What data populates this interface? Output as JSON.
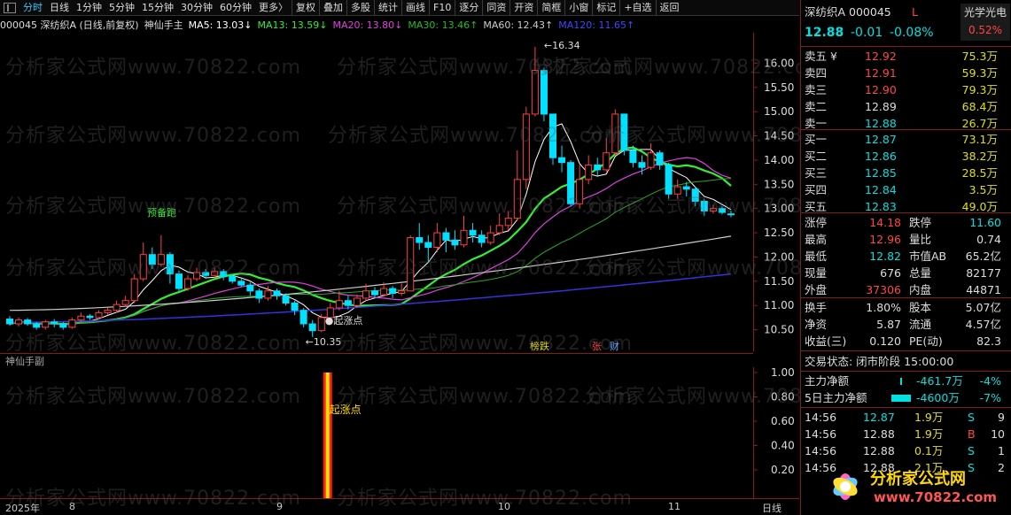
{
  "toolbar": {
    "items": [
      "分时",
      "日线",
      "1分钟",
      "5分钟",
      "15分钟",
      "30分钟",
      "60分钟",
      "更多〉",
      "复权",
      "叠加",
      "多股",
      "统计",
      "画线",
      "F10",
      "逐分",
      "同资",
      "开资",
      "简框",
      "小窗",
      "标记",
      "+自选",
      "返回"
    ]
  },
  "info": {
    "code_title": "000045 深纺织A (日线,前复权)",
    "indicator": "神仙手主",
    "ma5": "MA5: 13.03↓",
    "ma13": "MA13: 13.59↓",
    "ma20": "MA20: 13.80↓",
    "ma30": "MA30: 13.46↑",
    "ma60": "MA60: 12.43↑",
    "ma120": "MA120: 11.65↑"
  },
  "colors": {
    "ma5": "#ffffff",
    "ma13": "#33ee33",
    "ma20": "#e040e0",
    "ma30": "#22aa22",
    "ma60": "#cccccc",
    "ma120": "#3333dd",
    "up": "#ff4040",
    "down": "#00e0ff"
  },
  "chart_data": {
    "type": "candlestick",
    "y_ticks": [
      "16.00",
      "15.50",
      "15.00",
      "14.50",
      "14.00",
      "13.50",
      "13.00",
      "12.50",
      "12.00",
      "11.50",
      "11.00",
      "10.50"
    ],
    "ylim": [
      10.2,
      16.3
    ],
    "x_labels": [
      "2025年",
      "8",
      "9",
      "10",
      "11",
      "日线"
    ],
    "annotations": {
      "high": "16.34",
      "low": "10.35",
      "start": "●起涨点",
      "ready": "预备跑",
      "bang": "榜跌",
      "zhang": "张",
      "cai": "财"
    },
    "candles": [
      [
        10.72,
        10.62,
        10.78,
        10.58
      ],
      [
        10.62,
        10.7,
        10.75,
        10.57
      ],
      [
        10.7,
        10.62,
        10.74,
        10.58
      ],
      [
        10.62,
        10.55,
        10.66,
        10.5
      ],
      [
        10.55,
        10.66,
        10.7,
        10.5
      ],
      [
        10.66,
        10.62,
        10.72,
        10.55
      ],
      [
        10.62,
        10.55,
        10.66,
        10.5
      ],
      [
        10.55,
        10.7,
        10.75,
        10.52
      ],
      [
        10.7,
        10.78,
        10.85,
        10.66
      ],
      [
        10.78,
        10.75,
        10.82,
        10.7
      ],
      [
        10.75,
        10.85,
        10.9,
        10.72
      ],
      [
        10.85,
        10.9,
        10.95,
        10.8
      ],
      [
        10.9,
        11.02,
        11.1,
        10.85
      ],
      [
        11.02,
        11.1,
        11.2,
        10.98
      ],
      [
        11.1,
        11.55,
        11.65,
        11.05
      ],
      [
        11.55,
        12.05,
        12.3,
        11.5
      ],
      [
        12.05,
        11.85,
        12.2,
        11.75
      ],
      [
        11.85,
        12.05,
        12.45,
        11.8
      ],
      [
        12.05,
        11.65,
        12.1,
        11.45
      ],
      [
        11.65,
        11.35,
        11.72,
        11.28
      ],
      [
        11.35,
        11.55,
        11.62,
        11.3
      ],
      [
        11.55,
        11.68,
        11.78,
        11.5
      ],
      [
        11.68,
        11.62,
        11.75,
        11.55
      ],
      [
        11.62,
        11.7,
        11.78,
        11.56
      ],
      [
        11.7,
        11.6,
        11.75,
        11.52
      ],
      [
        11.6,
        11.5,
        11.65,
        11.45
      ],
      [
        11.5,
        11.42,
        11.55,
        11.38
      ],
      [
        11.42,
        11.3,
        11.48,
        11.2
      ],
      [
        11.3,
        11.15,
        11.35,
        11.05
      ],
      [
        11.15,
        11.3,
        11.4,
        11.1
      ],
      [
        11.3,
        11.2,
        11.35,
        11.12
      ],
      [
        11.2,
        11.05,
        11.25,
        11.0
      ],
      [
        11.05,
        10.9,
        11.1,
        10.8
      ],
      [
        10.9,
        10.62,
        10.95,
        10.55
      ],
      [
        10.62,
        10.48,
        10.7,
        10.35
      ],
      [
        10.48,
        10.75,
        10.82,
        10.45
      ],
      [
        10.75,
        10.95,
        11.05,
        10.7
      ],
      [
        10.95,
        11.1,
        11.3,
        10.9
      ],
      [
        11.1,
        11.0,
        11.2,
        10.92
      ],
      [
        11.0,
        11.15,
        11.22,
        10.95
      ],
      [
        11.15,
        11.3,
        11.45,
        11.1
      ],
      [
        11.3,
        11.22,
        11.38,
        11.15
      ],
      [
        11.22,
        11.35,
        11.48,
        11.18
      ],
      [
        11.35,
        11.25,
        11.4,
        11.15
      ],
      [
        11.25,
        11.3,
        11.45,
        11.2
      ],
      [
        11.3,
        12.4,
        12.45,
        11.3
      ],
      [
        12.4,
        12.3,
        12.7,
        12.15
      ],
      [
        12.3,
        12.2,
        12.45,
        11.9
      ],
      [
        12.2,
        12.5,
        12.7,
        12.1
      ],
      [
        12.5,
        12.35,
        12.6,
        12.1
      ],
      [
        12.35,
        12.25,
        12.55,
        12.15
      ],
      [
        12.25,
        12.55,
        12.85,
        12.2
      ],
      [
        12.55,
        12.45,
        12.7,
        12.3
      ],
      [
        12.45,
        12.3,
        12.55,
        12.2
      ],
      [
        12.3,
        12.5,
        12.65,
        12.25
      ],
      [
        12.5,
        12.65,
        12.9,
        12.45
      ],
      [
        12.65,
        12.8,
        12.95,
        12.55
      ],
      [
        12.8,
        13.6,
        14.2,
        12.75
      ],
      [
        13.6,
        14.95,
        15.1,
        13.4
      ],
      [
        14.95,
        15.85,
        16.34,
        14.9
      ],
      [
        15.85,
        14.95,
        15.9,
        14.8
      ],
      [
        14.95,
        14.05,
        14.95,
        13.9
      ],
      [
        14.05,
        13.95,
        14.3,
        13.75
      ],
      [
        13.95,
        13.1,
        14.0,
        13.05
      ],
      [
        13.1,
        13.6,
        13.9,
        13.0
      ],
      [
        13.6,
        13.9,
        14.1,
        13.5
      ],
      [
        13.9,
        13.8,
        14.05,
        13.65
      ],
      [
        13.8,
        14.15,
        14.45,
        13.75
      ],
      [
        14.15,
        14.95,
        15.05,
        14.1
      ],
      [
        14.95,
        14.2,
        14.95,
        14.1
      ],
      [
        14.2,
        13.95,
        14.3,
        13.85
      ],
      [
        13.95,
        13.85,
        14.1,
        13.7
      ],
      [
        13.85,
        14.15,
        14.35,
        13.8
      ],
      [
        14.15,
        13.9,
        14.2,
        13.8
      ],
      [
        13.9,
        13.3,
        13.95,
        13.2
      ],
      [
        13.3,
        13.45,
        13.6,
        13.2
      ],
      [
        13.45,
        13.4,
        13.55,
        13.25
      ],
      [
        13.4,
        13.15,
        13.45,
        13.05
      ],
      [
        13.15,
        12.95,
        13.2,
        12.85
      ],
      [
        12.95,
        13.0,
        13.08,
        12.9
      ],
      [
        13.0,
        12.92,
        13.05,
        12.88
      ],
      [
        12.89,
        12.88,
        12.96,
        12.82
      ]
    ]
  },
  "sub": {
    "label": "神仙手副",
    "ticks": [
      "1.00",
      "0.80",
      "0.60",
      "0.40",
      "0.20"
    ],
    "signal": "起涨点"
  },
  "quote": {
    "title": "深纺织A 000045",
    "badge": "L",
    "tag": "光学光电",
    "tag_pct": "0.52%",
    "price": "12.88",
    "change": "-0.01",
    "pct": "-0.08%",
    "asks": [
      [
        "卖五 ¥",
        "12.92",
        "75.3万"
      ],
      [
        "卖四",
        "12.91",
        "59.3万"
      ],
      [
        "卖三",
        "12.90",
        "79.3万"
      ],
      [
        "卖二",
        "12.89",
        "68.4万"
      ],
      [
        "卖一",
        "12.88",
        "26.7万"
      ]
    ],
    "bids": [
      [
        "买一",
        "12.87",
        "73.1万"
      ],
      [
        "买二",
        "12.86",
        "38.2万"
      ],
      [
        "买三",
        "12.85",
        "28.5万"
      ],
      [
        "买四",
        "12.84",
        "3.5万"
      ],
      [
        "买五",
        "12.83",
        "49.0万"
      ]
    ],
    "stats": [
      [
        "涨停",
        "14.18",
        "跌停",
        "11.60"
      ],
      [
        "最高",
        "12.96",
        "量比",
        "0.74"
      ],
      [
        "最低",
        "12.82",
        "市值AB",
        "65.2亿"
      ],
      [
        "现量",
        "676",
        "总量",
        "82177"
      ],
      [
        "外盘",
        "37306",
        "内盘",
        "44871"
      ]
    ],
    "stats2": [
      [
        "换手",
        "1.80%",
        "股本",
        "5.07亿"
      ],
      [
        "净资",
        "5.87",
        "流通",
        "4.57亿"
      ],
      [
        "收益(三)",
        "0.120",
        "PE(动)",
        "82.3"
      ]
    ],
    "status": "交易状态: 闭市阶段 15:00:00",
    "flow1_label": "主力净额",
    "flow1_val": "-461.7万",
    "flow1_pct": "-4%",
    "flow2_label": "5日主力净额",
    "flow2_val": "-4600万",
    "flow2_pct": "-7%",
    "ticks": [
      [
        "14:56",
        "12.87",
        "1.9万",
        "S",
        "9"
      ],
      [
        "14:56",
        "12.88",
        "1.9万",
        "B",
        "10"
      ],
      [
        "14:56",
        "12.88",
        "0.1万",
        "S",
        "1"
      ],
      [
        "14:56",
        "12.88",
        "2.1万",
        "S",
        "2"
      ]
    ]
  },
  "watermark": "分析家公式网www.70822.com",
  "logo": {
    "text": "分析家公式网",
    "url": "www.70822.com"
  }
}
